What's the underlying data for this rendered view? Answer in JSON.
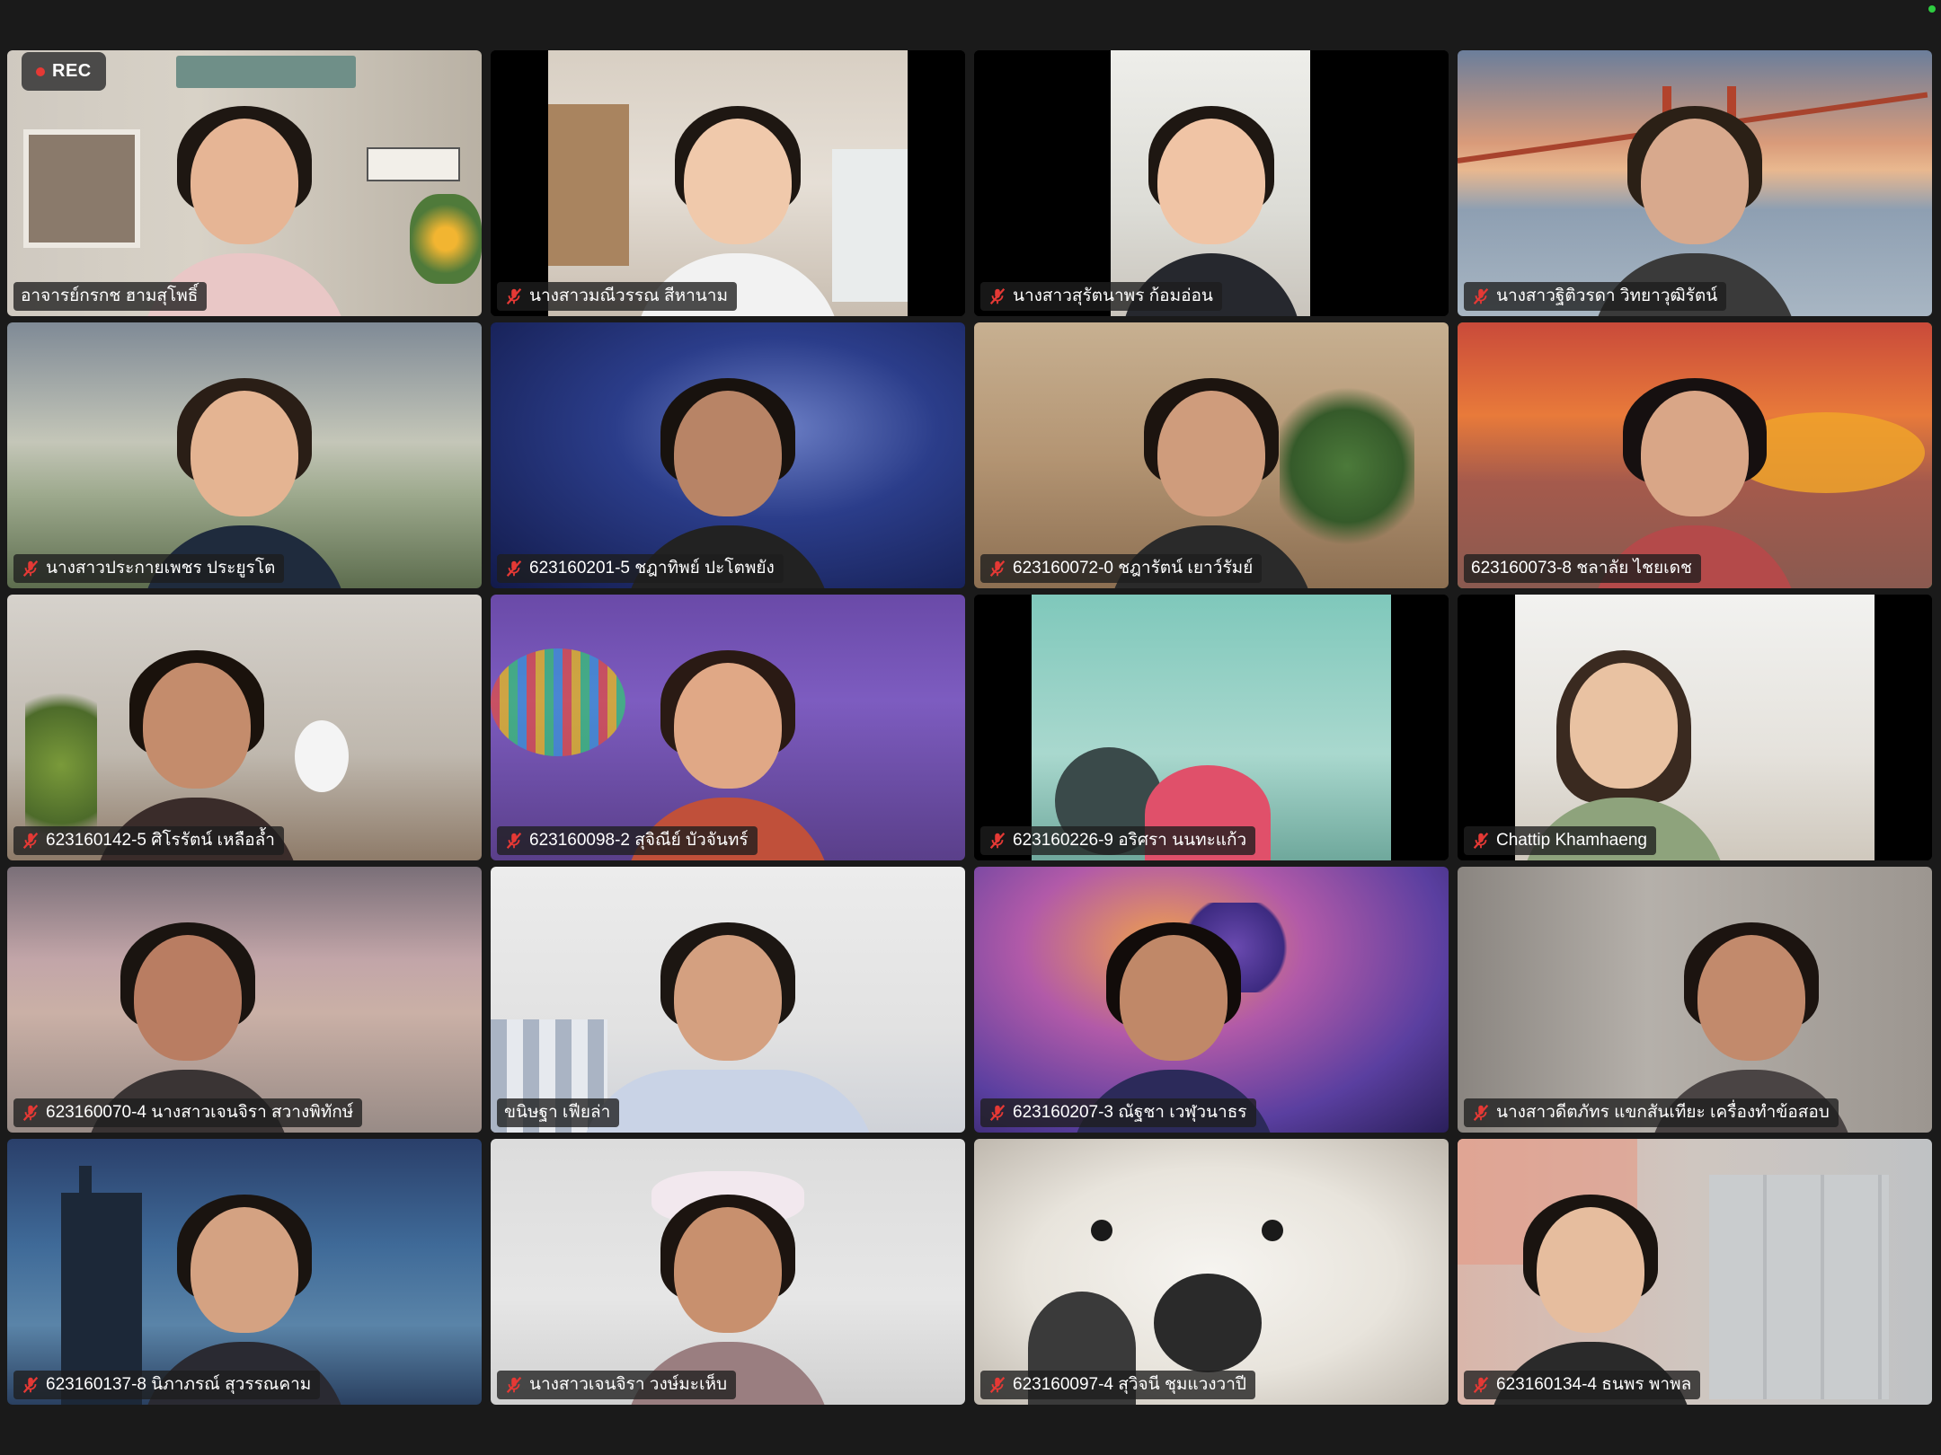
{
  "recording": {
    "label": "REC"
  },
  "tiles": [
    {
      "name": "อาจารย์กรกช ฮามสุโพธิ์",
      "muted": false
    },
    {
      "name": "นางสาวมณีวรรณ สีหานาม",
      "muted": true
    },
    {
      "name": "นางสาวสุรัตนาพร ก้อมอ่อน",
      "muted": true
    },
    {
      "name": "นางสาวฐิติวรดา วิทยาวุฒิรัตน์",
      "muted": true
    },
    {
      "name": "นางสาวประกายเพชร ประยูรโต",
      "muted": true
    },
    {
      "name": "623160201-5 ชฎาทิพย์ ปะโตพยัง",
      "muted": true
    },
    {
      "name": "623160072-0 ชฎารัตน์ เยาว์รัมย์",
      "muted": true
    },
    {
      "name": "623160073-8 ชลาลัย ไชยเดช",
      "muted": false,
      "active_speaker": true
    },
    {
      "name": "623160142-5 ศิโรรัตน์ เหลือล้ำ",
      "muted": true
    },
    {
      "name": "623160098-2 สุจิณีย์ บัวจันทร์",
      "muted": true
    },
    {
      "name": "623160226-9 อริศรา นนทะแก้ว",
      "muted": true
    },
    {
      "name": "Chattip Khamhaeng",
      "muted": true
    },
    {
      "name": "623160070-4 นางสาวเจนจิรา สวางพิทักษ์",
      "muted": true
    },
    {
      "name": "ขนิษฐา เฟียล่า",
      "muted": false
    },
    {
      "name": "623160207-3 ณัฐชา เวฬุวนาธร",
      "muted": true
    },
    {
      "name": "นางสาวดีตภัทร แขกสันเทียะ เครื่องทำข้อสอบ",
      "muted": true
    },
    {
      "name": "623160137-8 นิภาภรณ์ สุวรรณคาม",
      "muted": true
    },
    {
      "name": "นางสาวเจนจิรา วงษ์มะเห็บ",
      "muted": true
    },
    {
      "name": "623160097-4 สุวิจนี ชุมแวงวาปี",
      "muted": true
    },
    {
      "name": "623160134-4 ธนพร พาพล",
      "muted": true
    }
  ]
}
